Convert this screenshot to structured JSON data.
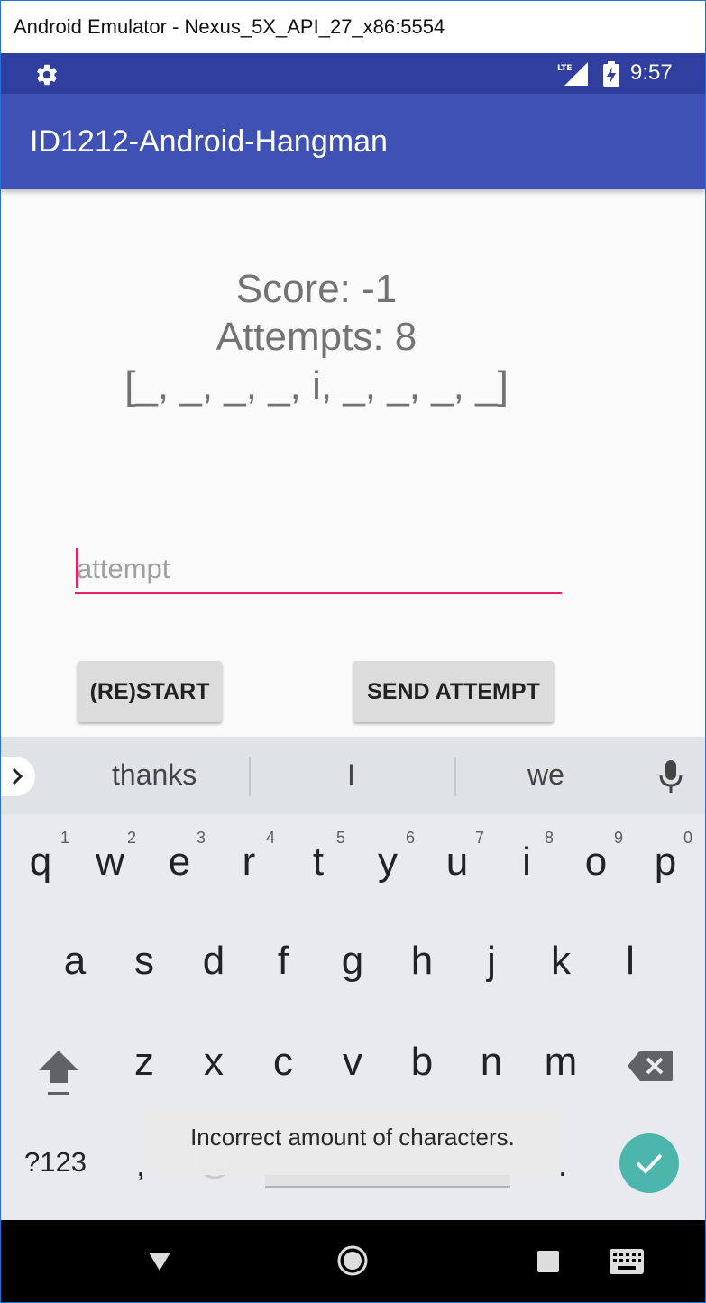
{
  "window": {
    "title": "Android Emulator - Nexus_5X_API_27_x86:5554"
  },
  "status_bar": {
    "time": "9:57",
    "network": "LTE"
  },
  "app_bar": {
    "title": "ID1212-Android-Hangman"
  },
  "game": {
    "score": "Score: -1",
    "attempts": "Attempts: 8",
    "word": "[_, _, _, _, i, _, _, _, _]"
  },
  "attempt_input": {
    "value": "",
    "placeholder": "attempt"
  },
  "buttons": {
    "restart": "(RE)START",
    "send_attempt": "SEND ATTEMPT"
  },
  "keyboard": {
    "suggestions": [
      "thanks",
      "I",
      "we"
    ],
    "row1": [
      "q",
      "w",
      "e",
      "r",
      "t",
      "y",
      "u",
      "i",
      "o",
      "p"
    ],
    "row1_hints": [
      "1",
      "2",
      "3",
      "4",
      "5",
      "6",
      "7",
      "8",
      "9",
      "0"
    ],
    "row2": [
      "a",
      "s",
      "d",
      "f",
      "g",
      "h",
      "j",
      "k",
      "l"
    ],
    "row3": [
      "z",
      "x",
      "c",
      "v",
      "b",
      "n",
      "m"
    ],
    "symbols_key": "?123",
    "comma_key": ",",
    "period_key": "."
  },
  "toast": {
    "message": "Incorrect amount of characters."
  },
  "colors": {
    "status_bar": "#303f9f",
    "app_bar": "#3f51b5",
    "accent": "#e91e63",
    "enter_key": "#4db6ac",
    "text_secondary": "#737373"
  }
}
